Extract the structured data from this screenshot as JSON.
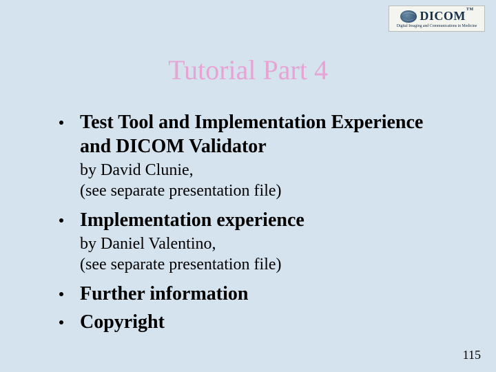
{
  "logo": {
    "brand": "DICOM",
    "tm": "TM",
    "tagline": "Digital Imaging and Communications in Medicine"
  },
  "title": "Tutorial Part 4",
  "bullets": [
    {
      "heading": "Test Tool and Implementation Experience and DICOM Validator",
      "sub": "by David Clunie,\n(see separate presentation file)"
    },
    {
      "heading": "Implementation experience",
      "sub": "by Daniel Valentino,\n(see separate presentation file)"
    },
    {
      "heading": "Further information"
    },
    {
      "heading": "Copyright"
    }
  ],
  "page_number": "115"
}
